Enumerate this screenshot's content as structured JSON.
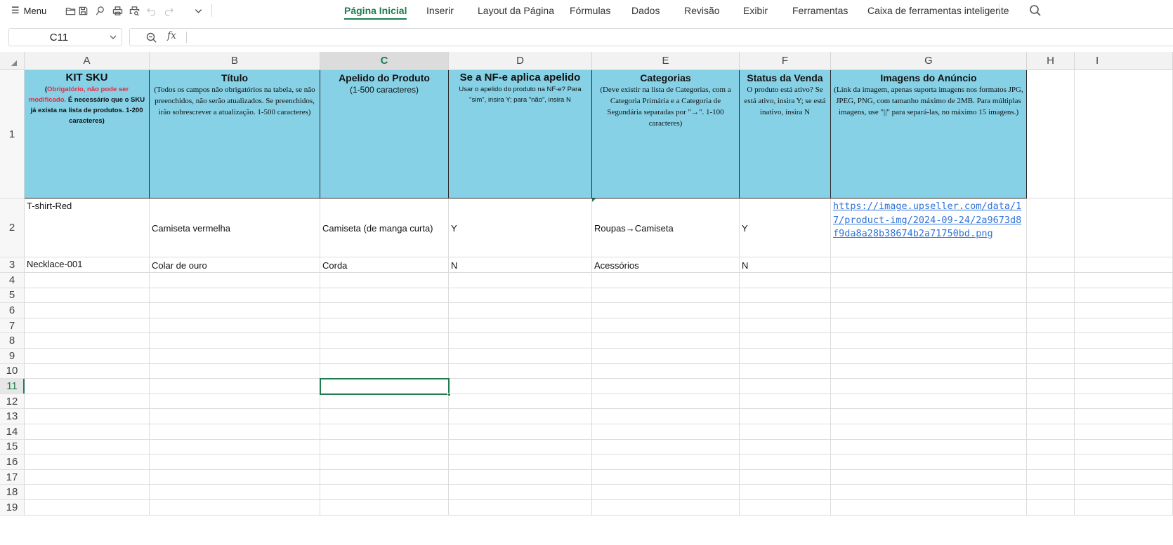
{
  "toolbar": {
    "menu_label": "Menu",
    "nav_tabs": [
      {
        "label": "Página Inicial",
        "active": true
      },
      {
        "label": "Inserir",
        "active": false
      },
      {
        "label": "Layout da Página",
        "active": false
      },
      {
        "label": "Fórmulas",
        "active": false
      },
      {
        "label": "Dados",
        "active": false
      },
      {
        "label": "Revisão",
        "active": false
      },
      {
        "label": "Exibir",
        "active": false
      },
      {
        "label": "Ferramentas",
        "active": false
      },
      {
        "label": "Caixa de ferramentas inteligente",
        "active": false
      }
    ],
    "icons": [
      "folder-open-icon",
      "save-icon",
      "paint-brush-icon",
      "print-icon",
      "print-preview-icon",
      "undo-icon",
      "redo-icon",
      "chevron-down-icon",
      "search-icon"
    ]
  },
  "formula_bar": {
    "cell_ref": "C11",
    "fx_label": "fx",
    "value": ""
  },
  "columns": [
    "A",
    "B",
    "C",
    "D",
    "E",
    "F",
    "G",
    "H",
    "I"
  ],
  "selected_column": "C",
  "rows": [
    "1",
    "2",
    "3",
    "4",
    "5",
    "6",
    "7",
    "8",
    "9",
    "10",
    "11",
    "12",
    "13",
    "14",
    "15",
    "16",
    "17",
    "18",
    "19"
  ],
  "selected_row": "11",
  "header_row": {
    "A": {
      "title": "KIT SKU",
      "desc_open": "(",
      "desc_red": "Obrigatório, não pode ser modificado.",
      "desc_rest": "É necessário que o SKU já exista na lista de produtos. 1-200 caracteres)"
    },
    "B": {
      "title": "Título",
      "desc": "(Todos os campos não obrigatórios na tabela, se não preenchidos, não serão atualizados. Se preenchidos, irão sobrescrever a atualização. 1-500 caracteres)"
    },
    "C": {
      "title": "Apelido do Produto",
      "desc": "(1-500 caracteres)"
    },
    "D": {
      "title": "Se a NF-e aplica apelido",
      "desc": "Usar o apelido do produto na NF-e? Para \"sim\", insira Y; para \"não\", insira N"
    },
    "E": {
      "title": "Categorias",
      "desc": "(Deve existir na lista de Categorias, com a Categoria Primária e a Categoria de Segundária separadas por \"→\". 1-100 caracteres)"
    },
    "F": {
      "title": "Status da Venda",
      "desc": "O produto está ativo? Se está ativo, insira Y; se está inativo, insira N"
    },
    "G": {
      "title": "Imagens do Anúncio",
      "desc": "(Link da imagem, apenas suporta imagens nos formatos JPG, JPEG, PNG, com tamanho máximo de 2MB. Para múltiplas imagens, use \"||\" para separá-las, no máximo 15 imagens.)"
    }
  },
  "data_rows": [
    {
      "A": "T-shirt-Red",
      "B": "Camiseta vermelha",
      "C": "Camiseta (de manga curta)",
      "D": "Y",
      "E": "Roupas→Camiseta",
      "F": "Y",
      "G": "https://image.upseller.com/data/17/product-img/2024-09-24/2a9673d8f9da8a28b38674b2a71750bd.png"
    },
    {
      "A": "Necklace-001",
      "B": "Colar de ouro",
      "C": "Corda",
      "D": "N",
      "E": "Acessórios",
      "F": "N",
      "G": ""
    }
  ],
  "colors": {
    "accent": "#1d7d4f",
    "header_fill": "#86d1e6",
    "required_red": "#e8283e",
    "link": "#2f74d8"
  }
}
